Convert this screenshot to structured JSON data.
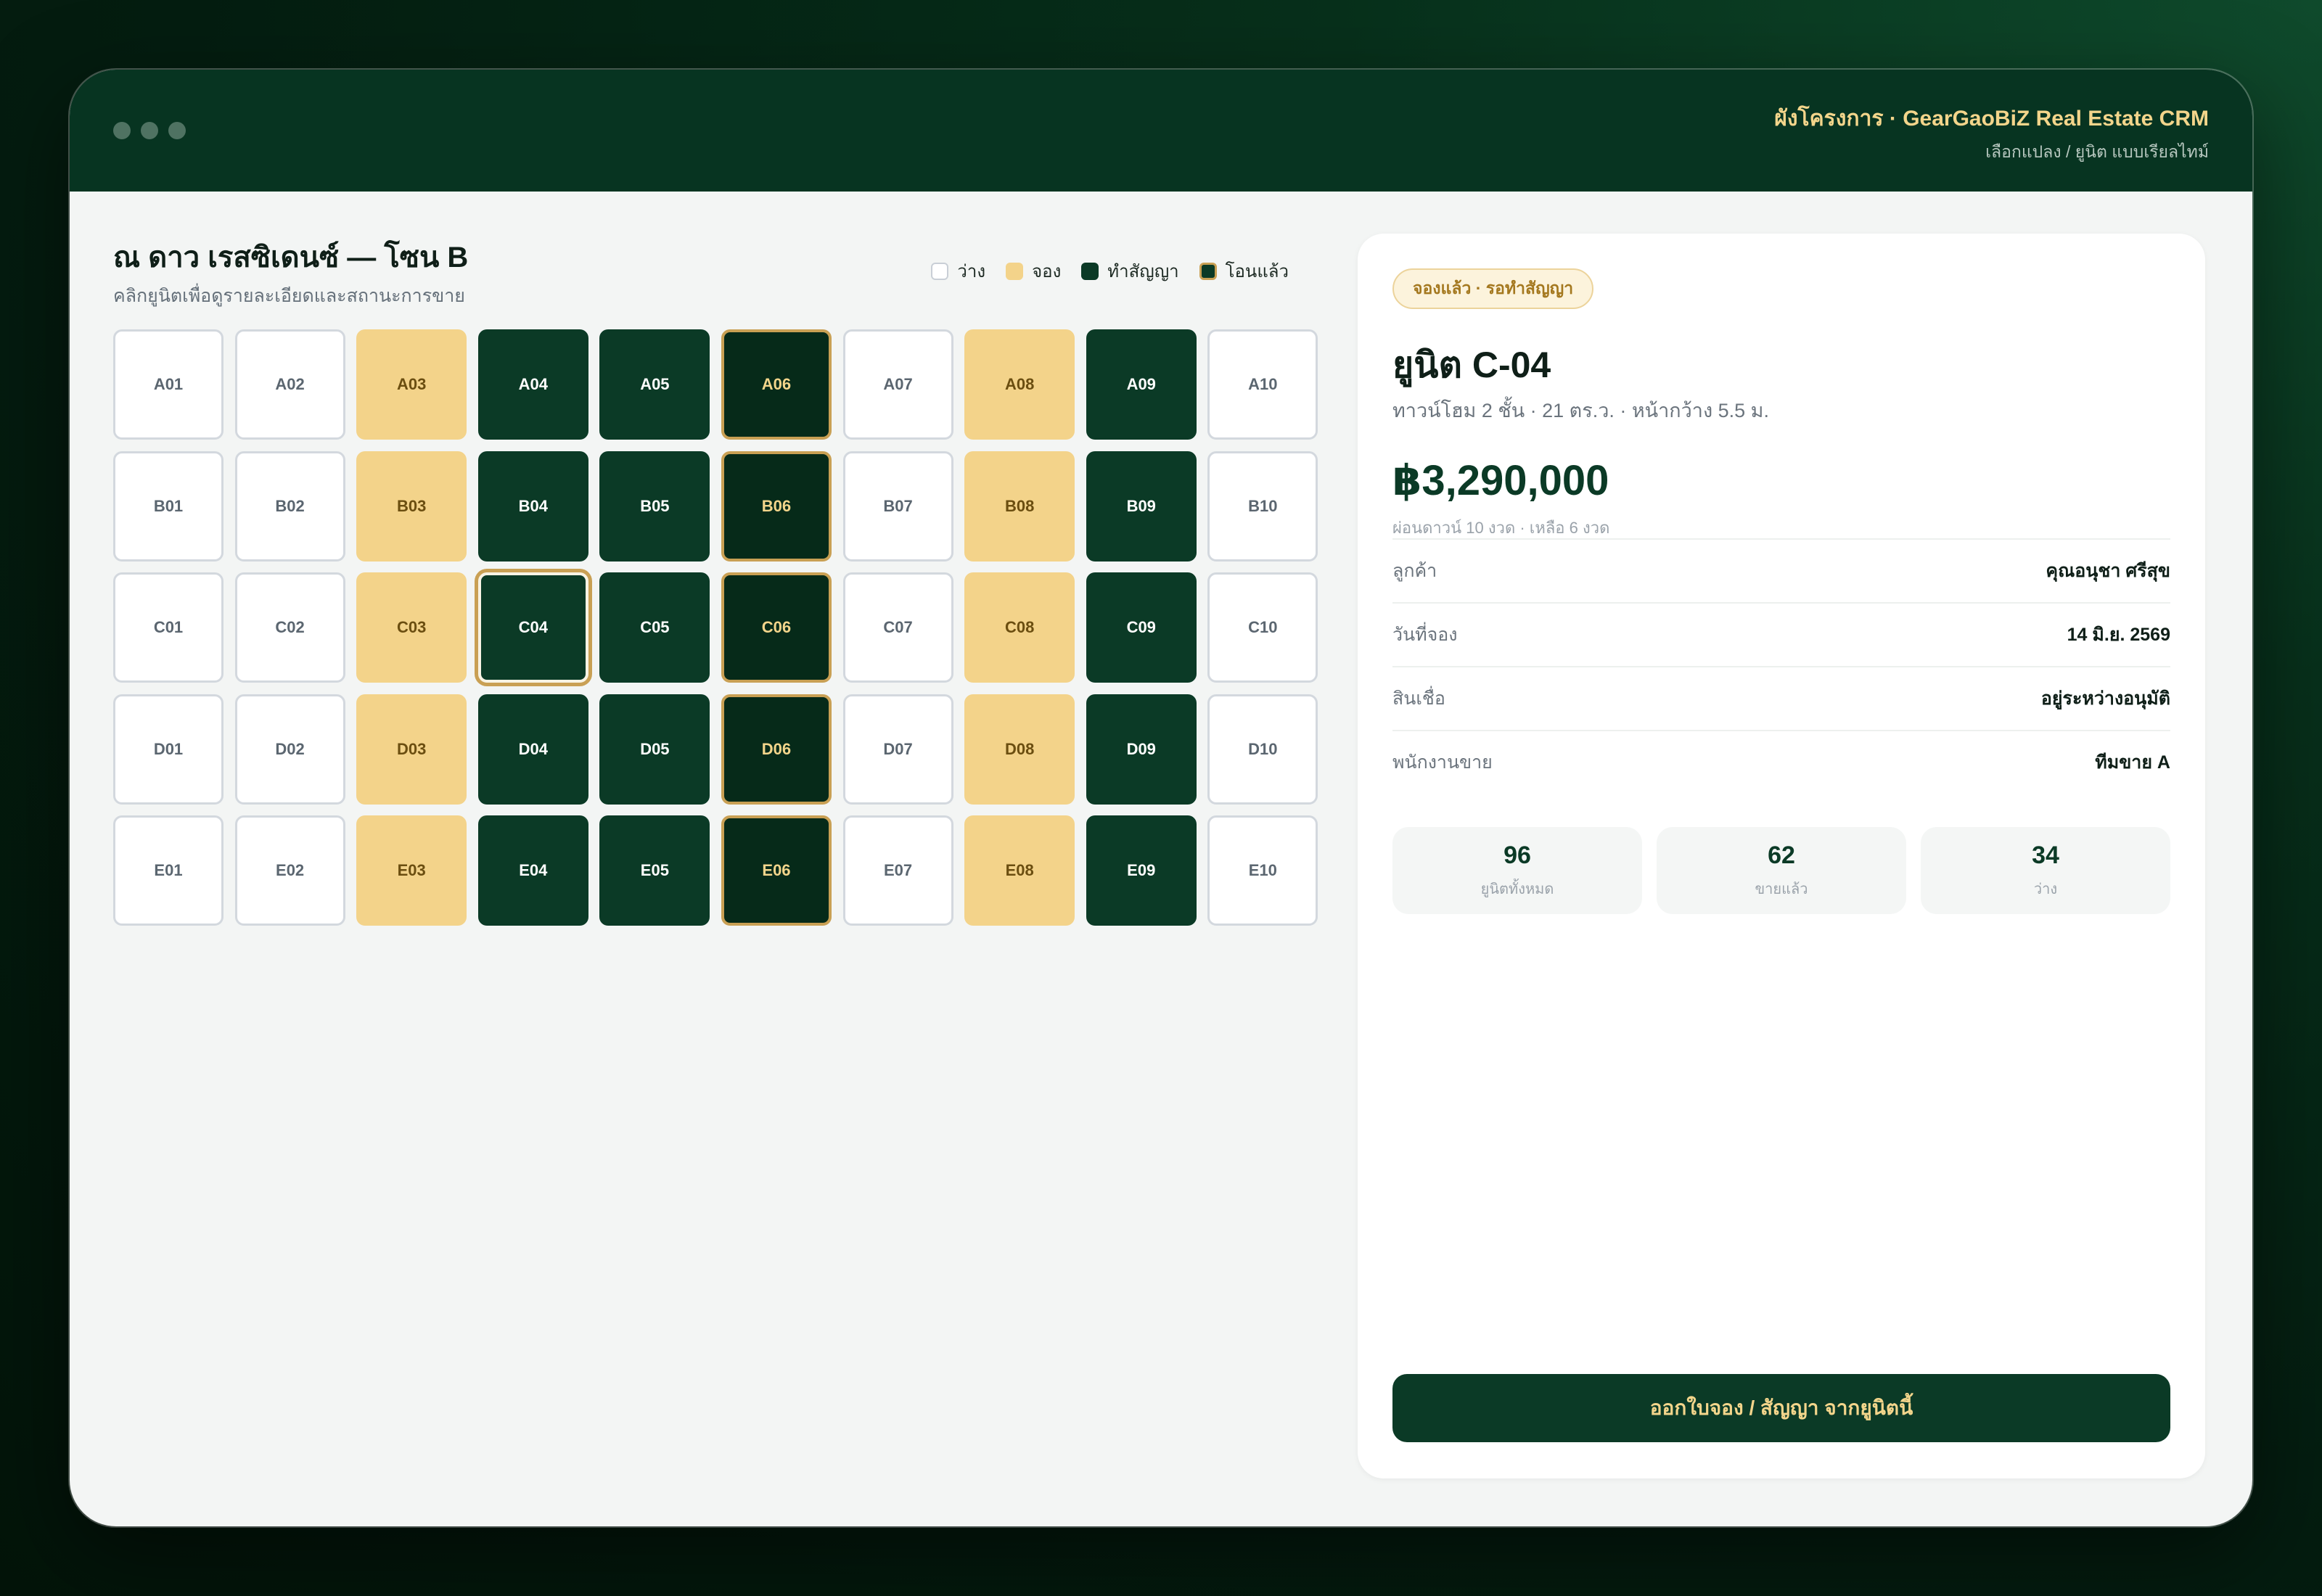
{
  "titlebar": {
    "title": "ผังโครงการ · GearGaoBiZ Real Estate CRM",
    "subtitle": "เลือกแปลง / ยูนิต แบบเรียลไทม์"
  },
  "plan": {
    "title": "ณ ดาว เรสซิเดนซ์ — โซน B",
    "subtitle": "คลิกยูนิตเพื่อดูรายละเอียดและสถานะการขาย",
    "legend": [
      {
        "key": "free",
        "label": "ว่าง"
      },
      {
        "key": "reserved",
        "label": "จอง"
      },
      {
        "key": "contract",
        "label": "ทำสัญญา"
      },
      {
        "key": "transferred",
        "label": "โอนแล้ว"
      }
    ],
    "rows": [
      "A",
      "B",
      "C",
      "D",
      "E"
    ],
    "column_status": [
      "free",
      "free",
      "reserved",
      "contract",
      "contract",
      "transferred",
      "free",
      "reserved",
      "contract",
      "free"
    ],
    "selected_unit": "C04"
  },
  "detail": {
    "badge": "จองแล้ว · รอทำสัญญา",
    "unit_name": "ยูนิต C-04",
    "description": "ทาวน์โฮม 2 ชั้น · 21 ตร.ว. · หน้ากว้าง 5.5 ม.",
    "price": "฿3,290,000",
    "installment": "ผ่อนดาวน์ 10 งวด · เหลือ 6 งวด",
    "fields": [
      {
        "label": "ลูกค้า",
        "value": "คุณอนุชา ศรีสุข"
      },
      {
        "label": "วันที่จอง",
        "value": "14 มิ.ย. 2569"
      },
      {
        "label": "สินเชื่อ",
        "value": "อยู่ระหว่างอนุมัติ"
      },
      {
        "label": "พนักงานขาย",
        "value": "ทีมขาย A"
      }
    ],
    "stats": [
      {
        "value": "96",
        "label": "ยูนิตทั้งหมด"
      },
      {
        "value": "62",
        "label": "ขายแล้ว"
      },
      {
        "value": "34",
        "label": "ว่าง"
      }
    ],
    "cta_label": "ออกใบจอง / สัญญา จากยูนิตนี้"
  },
  "colors": {
    "primary_green": "#0b3a26",
    "reserved_gold": "#f3d38a",
    "accent_gold": "#c9a054",
    "title_gold": "#f3d58b"
  }
}
